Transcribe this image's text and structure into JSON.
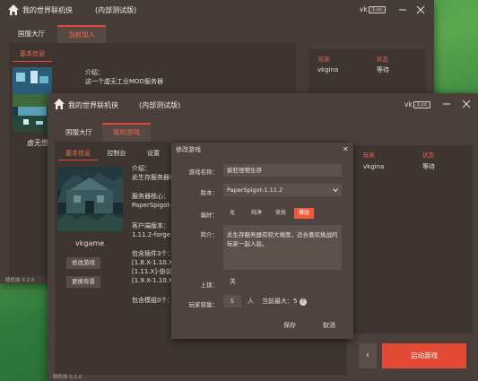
{
  "back_window": {
    "title": "我的世界联机侠",
    "subtitle": "(内部测试版)",
    "user": "vk",
    "badge": "1.xx",
    "tabs": [
      "国服大厅",
      "当前加入"
    ],
    "subtab": "基本信息",
    "intro_label": "介绍：",
    "intro_text": "这一个虚无工业MOD服务器",
    "server_name_partial": "虚无世",
    "players_header": [
      "玩家",
      "状态"
    ],
    "player_name": "vkgina",
    "player_status": "等待",
    "version": "联机侠 0.2.0"
  },
  "front_window": {
    "title": "我的世界联机侠",
    "subtitle": "(内部测试版)",
    "user": "vk",
    "badge": "1.xx",
    "tabs": [
      "国服大厅",
      "我的游戏"
    ],
    "subtabs": [
      "基本信息",
      "控制台",
      "设置"
    ],
    "server_name": "vkgame",
    "btn_edit": "修改游戏",
    "btn_bg": "更换背景",
    "info": {
      "intro_label": "介绍：",
      "intro_partial": "此生存服务器有",
      "core_label": "服务器核心：",
      "core_partial": "PaperSpigot-1",
      "client_label": "客户端版本：",
      "client_partial": "1.11.2-forge1",
      "plugins_label": "包含插件3个：",
      "plugin_1": "[1.8.X-1.10.X]",
      "plugin_2": "[1.11.X]-协议支",
      "plugin_3": "[1.9.X-1.10.X]",
      "mods_label": "包含模组0个："
    },
    "players_header": [
      "玩家",
      "状态"
    ],
    "player_name": "vkgina",
    "player_status": "等待",
    "back_symbol": "‹",
    "start_button": "启动游戏",
    "version": "联机侠 0.2.0"
  },
  "dialog": {
    "title": "修改游戏",
    "close": "✕",
    "name_label": "游戏名称：",
    "name_value": "疯狂怪物生存",
    "version_label": "版本：",
    "version_value": "PaperSpigot-1.11.2",
    "pref_label": "偏好：",
    "prefs": [
      "无",
      "纯净",
      "竞技",
      "模组"
    ],
    "pref_selected": "模组",
    "desc_label": "简介：",
    "desc_value": "此生存服务器有较大难度，适合喜欢挑战的玩家一起入驻。",
    "lock_label": "上锁：",
    "lock_value": "关",
    "capacity_label": "玩家容量：",
    "capacity_value": "5",
    "capacity_unit": "人",
    "capacity_max": "当前最大：5",
    "help": "?",
    "save": "保存",
    "cancel": "取消"
  },
  "colors": {
    "accent": "#e0493a",
    "window_bg": "#4a3f3a",
    "panel_bg": "#3e3531",
    "desktop": "#4b9a4a"
  }
}
